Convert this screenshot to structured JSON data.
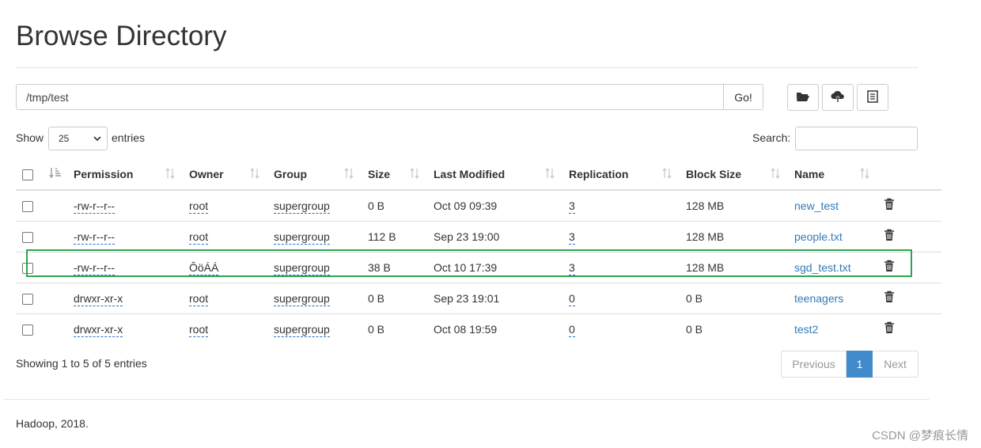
{
  "page": {
    "title": "Browse Directory",
    "path_value": "/tmp/test",
    "go_label": "Go!"
  },
  "toolbar": {
    "icons": [
      "folder-open-icon",
      "cloud-upload-icon",
      "list-icon"
    ]
  },
  "controls": {
    "show_label": "Show",
    "entries_value": "25",
    "entries_label": "entries",
    "search_label": "Search:",
    "search_value": ""
  },
  "table": {
    "headers": [
      "Permission",
      "Owner",
      "Group",
      "Size",
      "Last Modified",
      "Replication",
      "Block Size",
      "Name"
    ],
    "rows": [
      {
        "permission": "-rw-r--r--",
        "owner": "root",
        "group": "supergroup",
        "size": "0 B",
        "modified": "Oct 09 09:39",
        "replication": "3",
        "block_size": "128 MB",
        "name": "new_test"
      },
      {
        "permission": "-rw-r--r--",
        "owner": "root",
        "group": "supergroup",
        "size": "112 B",
        "modified": "Sep 23 19:00",
        "replication": "3",
        "block_size": "128 MB",
        "name": "people.txt"
      },
      {
        "permission": "-rw-r--r--",
        "owner": "ÔöÁÁ",
        "group": "supergroup",
        "size": "38 B",
        "modified": "Oct 10 17:39",
        "replication": "3",
        "block_size": "128 MB",
        "name": "sgd_test.txt"
      },
      {
        "permission": "drwxr-xr-x",
        "owner": "root",
        "group": "supergroup",
        "size": "0 B",
        "modified": "Sep 23 19:01",
        "replication": "0",
        "block_size": "0 B",
        "name": "teenagers"
      },
      {
        "permission": "drwxr-xr-x",
        "owner": "root",
        "group": "supergroup",
        "size": "0 B",
        "modified": "Oct 08 19:59",
        "replication": "0",
        "block_size": "0 B",
        "name": "test2"
      }
    ]
  },
  "pagination": {
    "info": "Showing 1 to 5 of 5 entries",
    "previous": "Previous",
    "current": "1",
    "next": "Next"
  },
  "footer": {
    "text": "Hadoop, 2018."
  },
  "watermark": {
    "text": "CSDN @梦痕长情"
  },
  "colors": {
    "link": "#337ab7",
    "active_page": "#428bca",
    "highlight_box": "#2ea44f"
  }
}
